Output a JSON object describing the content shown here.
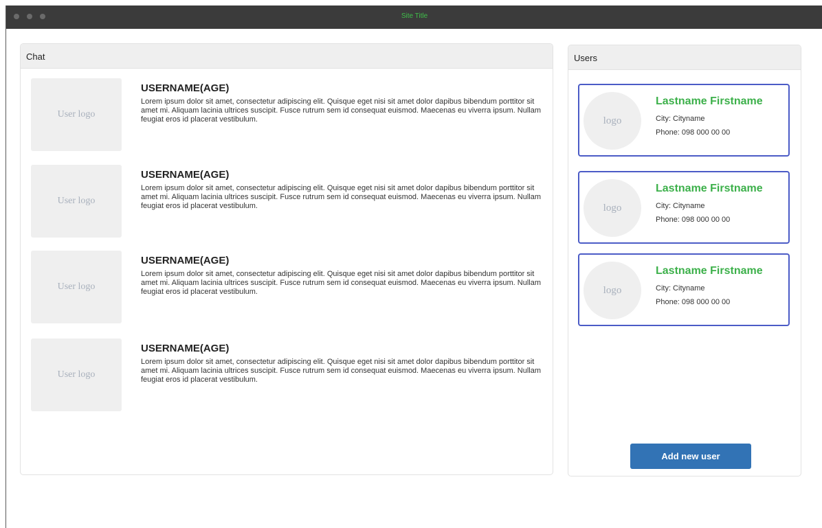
{
  "window": {
    "title": "Site Title"
  },
  "chat": {
    "header": "Chat",
    "messages": [
      {
        "logo_text": "User logo",
        "username": "USERNAME(AGE)",
        "text": "Lorem ipsum dolor sit amet, consectetur adipiscing elit. Quisque eget nisi sit amet dolor dapibus bibendum porttitor sit amet mi. Aliquam lacinia ultrices suscipit. Fusce rutrum sem id consequat euismod. Maecenas eu viverra ipsum. Nullam feugiat eros id placerat vestibulum."
      },
      {
        "logo_text": "User logo",
        "username": "USERNAME(AGE)",
        "text": "Lorem ipsum dolor sit amet, consectetur adipiscing elit. Quisque eget nisi sit amet dolor dapibus bibendum porttitor sit amet mi. Aliquam lacinia ultrices suscipit. Fusce rutrum sem id consequat euismod. Maecenas eu viverra ipsum. Nullam feugiat eros id placerat vestibulum."
      },
      {
        "logo_text": "User logo",
        "username": "USERNAME(AGE)",
        "text": "Lorem ipsum dolor sit amet, consectetur adipiscing elit. Quisque eget nisi sit amet dolor dapibus bibendum porttitor sit amet mi. Aliquam lacinia ultrices suscipit. Fusce rutrum sem id consequat euismod. Maecenas eu viverra ipsum. Nullam feugiat eros id placerat vestibulum."
      },
      {
        "logo_text": "User logo",
        "username": "USERNAME(AGE)",
        "text": "Lorem ipsum dolor sit amet, consectetur adipiscing elit. Quisque eget nisi sit amet dolor dapibus bibendum porttitor sit amet mi. Aliquam lacinia ultrices suscipit. Fusce rutrum sem id consequat euismod. Maecenas eu viverra ipsum. Nullam feugiat eros id placerat vestibulum."
      }
    ]
  },
  "users": {
    "header": "Users",
    "list": [
      {
        "logo_text": "logo",
        "name": "Lastname Firstname",
        "city": "City: Cityname",
        "phone": "Phone: 098 000 00 00"
      },
      {
        "logo_text": "logo",
        "name": "Lastname Firstname",
        "city": "City: Cityname",
        "phone": "Phone: 098 000 00 00"
      },
      {
        "logo_text": "logo",
        "name": "Lastname Firstname",
        "city": "City: Cityname",
        "phone": "Phone: 098 000 00 00"
      }
    ],
    "add_button_label": "Add new user"
  },
  "colors": {
    "title_bar": "#3b3b3b",
    "site_title": "#3fbf4a",
    "user_name": "#3cb04a",
    "card_border": "#4b5bc6",
    "button": "#3273b5"
  }
}
